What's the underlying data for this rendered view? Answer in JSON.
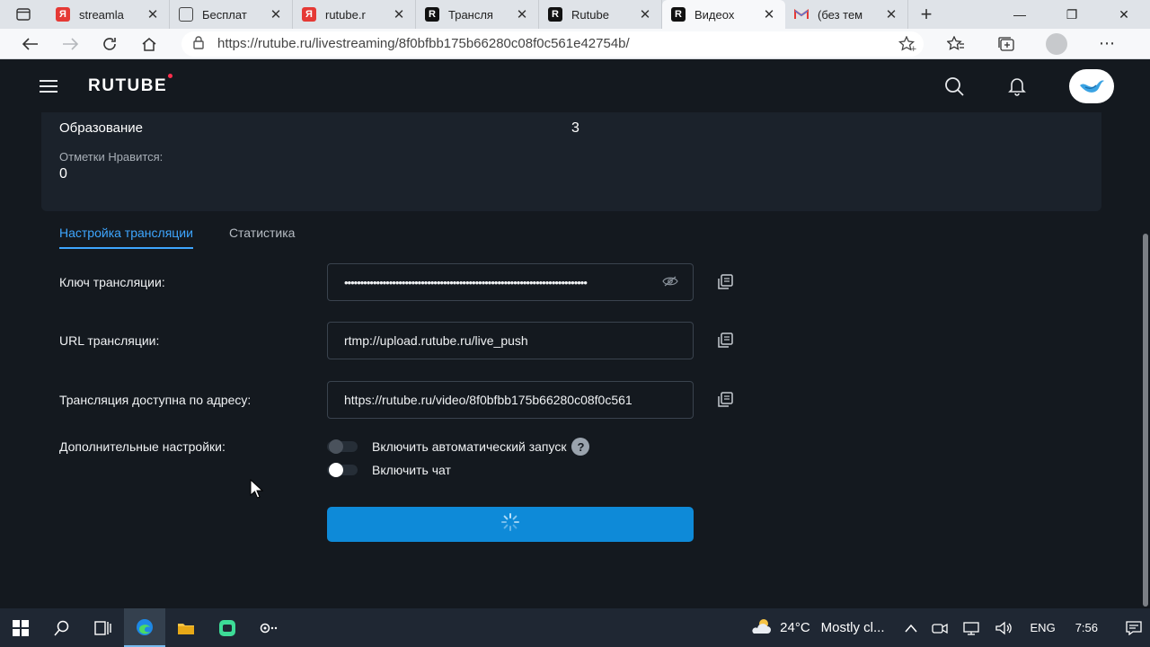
{
  "browser": {
    "tabs": [
      {
        "title": "streamla",
        "icon": "yandex-icon",
        "active": false
      },
      {
        "title": "Бесплат",
        "icon": "document-icon",
        "active": false
      },
      {
        "title": "rutube.r",
        "icon": "yandex-icon",
        "active": false
      },
      {
        "title": "Трансля",
        "icon": "rutube-icon",
        "active": false
      },
      {
        "title": "Rutube",
        "icon": "rutube-icon",
        "active": false
      },
      {
        "title": "Видеох",
        "icon": "rutube-icon",
        "active": true
      },
      {
        "title": "(без тем",
        "icon": "gmail-icon",
        "active": false
      }
    ],
    "url": "https://rutube.ru/livestreaming/8f0bfbb175b66280c08f0c561e42754b/"
  },
  "site": {
    "logo": "RUTUBE"
  },
  "info": {
    "category_value": "Образование",
    "count_value": "3",
    "likes_label": "Отметки Нравится:",
    "likes_value": "0"
  },
  "tabs": {
    "settings": "Настройка трансляции",
    "stats": "Статистика"
  },
  "form": {
    "key_label": "Ключ трансляции:",
    "key_value": "••••••••••••••••••••••••••••••••••••••••••••••••••••••••••••••••••••••••••••",
    "url_label": "URL трансляции:",
    "url_value": "rtmp://upload.rutube.ru/live_push",
    "address_label": "Трансляция доступна по адресу:",
    "address_value": "https://rutube.ru/video/8f0bfbb175b66280c08f0c561",
    "extra_label": "Дополнительные настройки:",
    "autostart_label": "Включить автоматический запуск",
    "autostart_on": false,
    "chat_label": "Включить чат",
    "chat_on": true,
    "help": "?"
  },
  "colors": {
    "accent": "#3ea6ff",
    "button": "#0e8ad8",
    "background": "#14191f",
    "card": "#1b222b"
  },
  "taskbar": {
    "temperature": "24°C",
    "weather": "Mostly cl...",
    "language": "ENG",
    "time": "7:56"
  }
}
